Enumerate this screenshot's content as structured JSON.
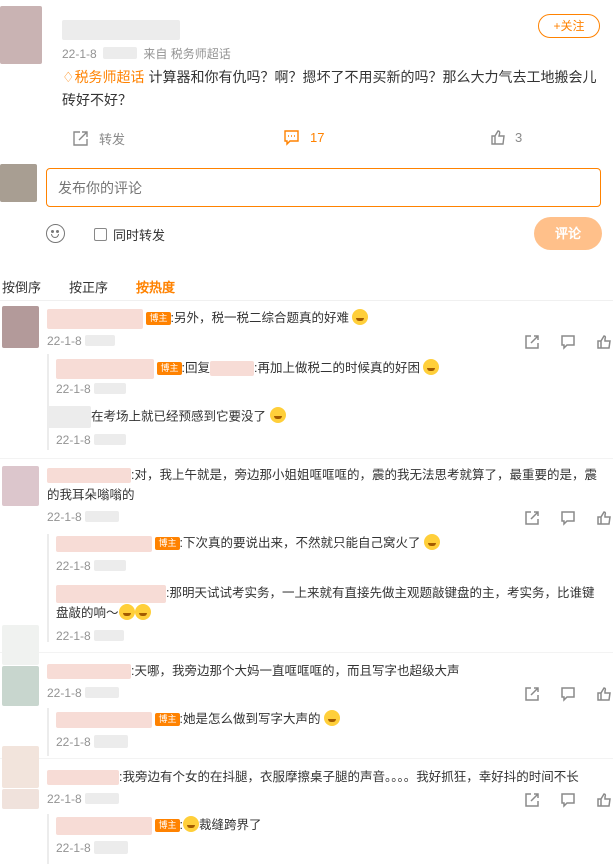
{
  "post": {
    "follow_label": "+关注",
    "date": "22-1-8",
    "source": "来自 税务师超话",
    "topic": "税务师超话",
    "text": "计算器和你有仇吗？啊？摁坏了不用买新的吗？那么大力气去工地搬会儿砖好不好？",
    "repost_label": "转发",
    "comment_count": "17",
    "like_count": "3"
  },
  "composer": {
    "placeholder": "发布你的评论",
    "also_repost": "同时转发",
    "submit": "评论"
  },
  "sort": {
    "latest": "按倒序",
    "oldest": "按正序",
    "hot": "按热度"
  },
  "badge": "博主",
  "comments": [
    {
      "text": ":另外，税一税二综合题真的好难",
      "date": "22-1-8"
    },
    {
      "text_prefix": ":回复",
      "text": ":再加上做税二的时候真的好困",
      "date": "22-1-8"
    },
    {
      "text": "在考场上就已经预感到它要没了",
      "date": "22-1-8"
    },
    {
      "text": ":对，我上午就是，旁边那小姐姐哐哐哐的，震的我无法思考就算了，最重要的是，震的我耳朵嗡嗡的",
      "date": "22-1-8"
    },
    {
      "text": ":下次真的要说出来，不然就只能自己窝火了",
      "date": "22-1-8"
    },
    {
      "text": ":那明天试试考实务，一上来就有直接先做主观题敲键盘的主，考实务，比谁键盘敲的响～",
      "date": "22-1-8"
    },
    {
      "text": ":天哪，我旁边那个大妈一直哐哐哐的，而且写字也超级大声",
      "date": "22-1-8"
    },
    {
      "text": ":她是怎么做到写字大声的",
      "date": "22-1-8"
    },
    {
      "text": ":我旁边有个女的在抖腿，衣服摩擦桌子腿的声音。。。。我好抓狂，幸好抖的时间不长",
      "date": "22-1-8"
    },
    {
      "text": "裁缝跨界了",
      "date": "22-1-8"
    }
  ]
}
